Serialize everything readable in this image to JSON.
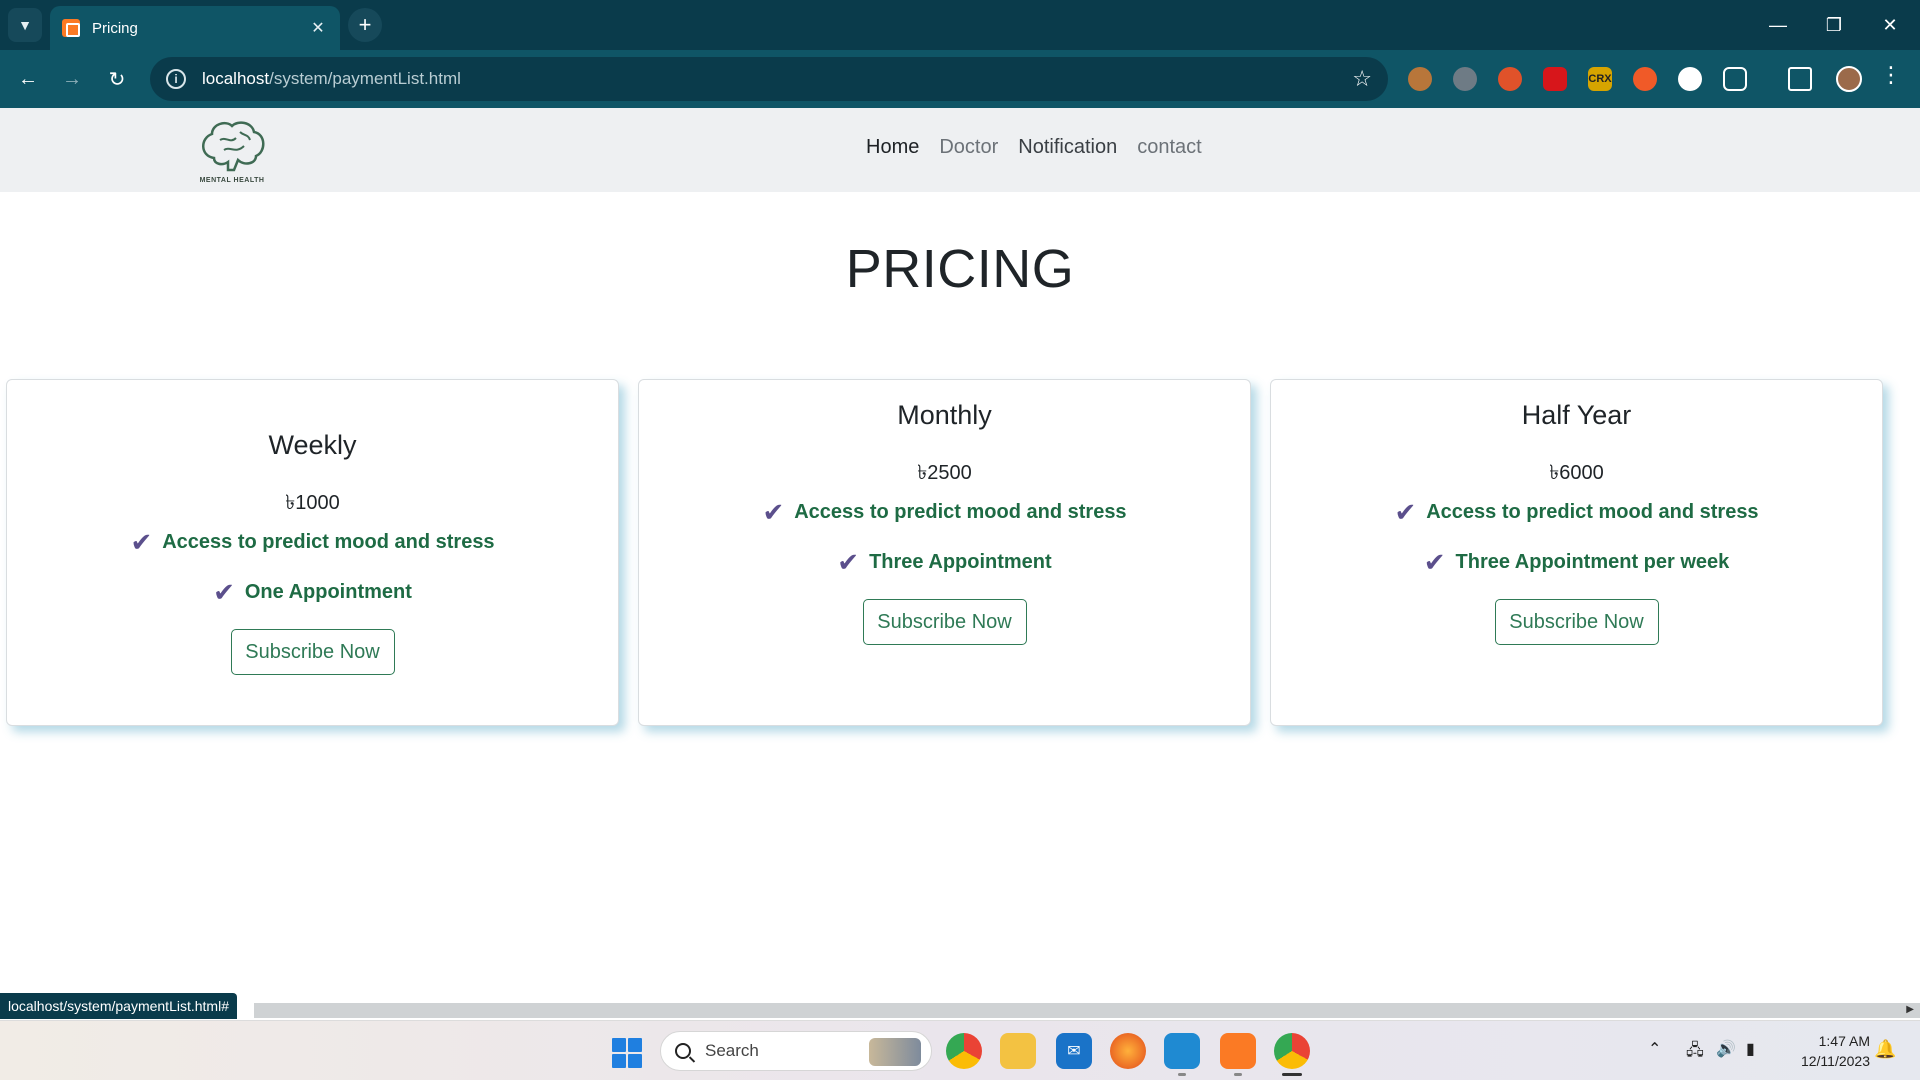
{
  "browser": {
    "tab_title": "Pricing",
    "url_host": "localhost",
    "url_path": "/system/paymentList.html",
    "status_url": "localhost/system/paymentList.html#"
  },
  "nav": {
    "logo_text": "MENTAL HEALTH",
    "links": [
      "Home",
      "Doctor",
      "Notification",
      "contact"
    ]
  },
  "page": {
    "title": "PRICING"
  },
  "plans": [
    {
      "name": "Weekly",
      "price": "৳1000",
      "features": [
        "Access to predict mood and stress",
        "One Appointment"
      ],
      "button": "Subscribe Now"
    },
    {
      "name": "Monthly",
      "price": "৳2500",
      "features": [
        "Access to predict mood and stress",
        "Three Appointment"
      ],
      "button": "Subscribe Now"
    },
    {
      "name": "Half Year",
      "price": "৳6000",
      "features": [
        "Access to predict mood and stress",
        "Three Appointment per week"
      ],
      "button": "Subscribe Now"
    }
  ],
  "taskbar": {
    "search_label": "Search",
    "time": "1:47 AM",
    "date": "12/11/2023"
  },
  "colors": {
    "accent_green": "#1e6b44",
    "check_purple": "#5b4f8c",
    "browser_chrome": "#0f5566"
  },
  "icons": {
    "check": "✔",
    "star": "☆"
  }
}
